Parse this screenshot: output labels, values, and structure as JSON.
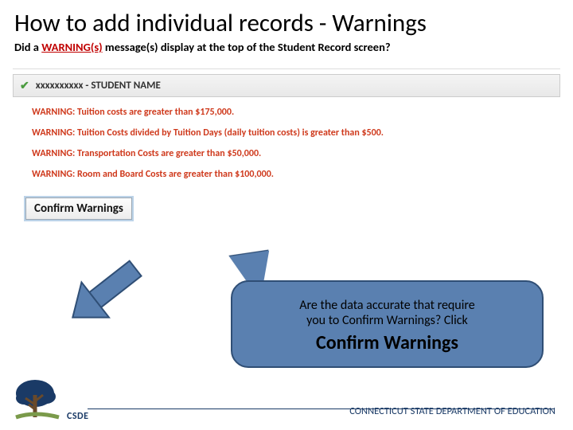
{
  "title": "How to add individual records - Warnings",
  "subtitle_pre": "Did a ",
  "subtitle_warn": "WARNING(s)",
  "subtitle_post": " message(s) display at the top of the Student Record screen?",
  "student_bar": "xxxxxxxxxx  -  STUDENT NAME",
  "warnings": [
    "WARNING: Tuition costs are greater than $175,000.",
    "WARNING: Tuition Costs divided by Tuition Days (daily tuition costs) is greater than $500.",
    "WARNING: Transportation Costs are greater than $50,000.",
    "WARNING: Room and Board Costs are greater than $100,000."
  ],
  "confirm_button": "Confirm Warnings",
  "callout_line1": "Are the data accurate that require",
  "callout_line2": "you to Confirm Warnings? Click",
  "callout_big": "Confirm Warnings",
  "logo_text": "CSDE",
  "footer_org": "CONNECTICUT STATE DEPARTMENT OF EDUCATION"
}
